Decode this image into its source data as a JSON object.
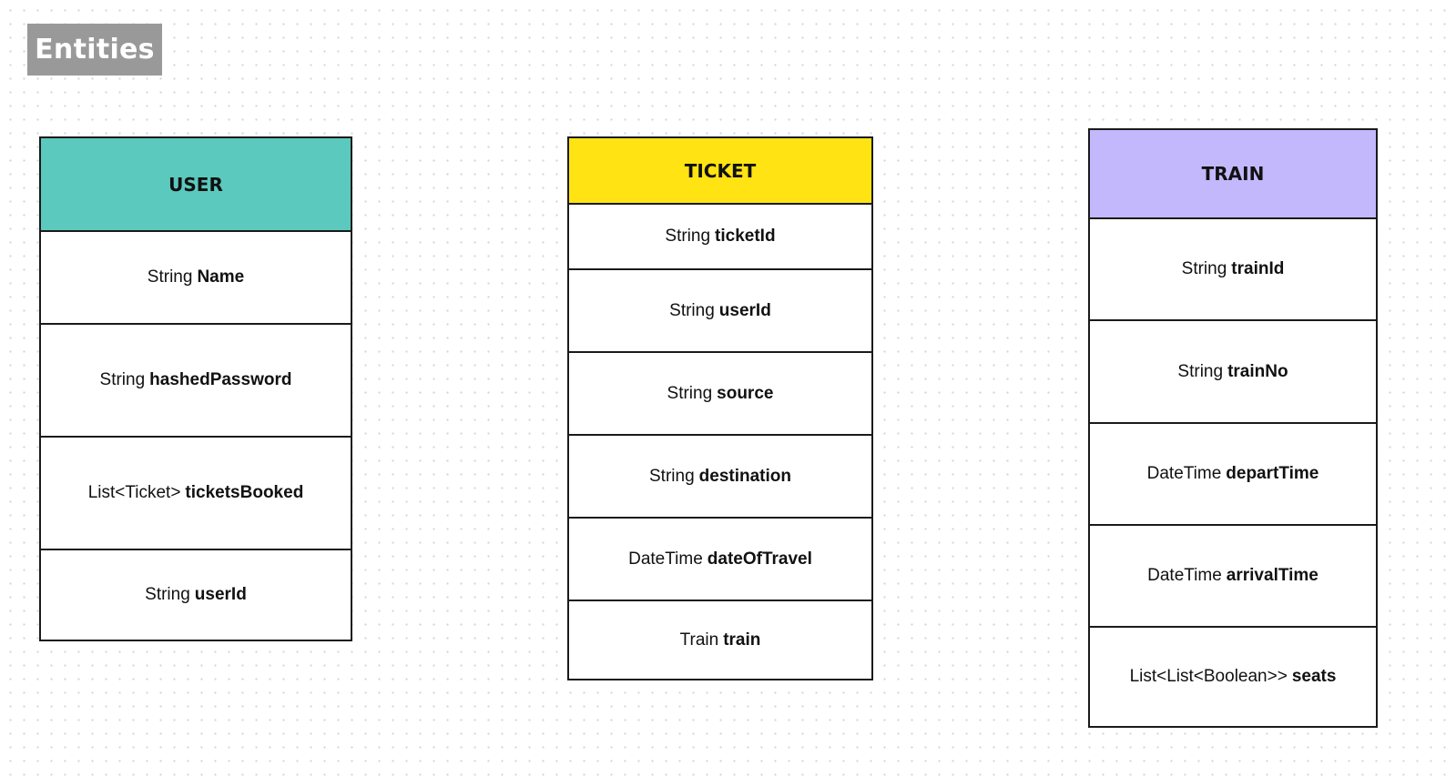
{
  "page": {
    "label": "Entities"
  },
  "colors": {
    "user_header": "#5bc9bd",
    "ticket_header": "#ffe312",
    "train_header": "#c4b8fc",
    "label_background": "#999999",
    "border": "#1a1a1a"
  },
  "entities": [
    {
      "id": "user",
      "title": "USER",
      "fields": [
        {
          "type": "String",
          "name": "Name"
        },
        {
          "type": "String",
          "name": "hashedPassword"
        },
        {
          "type": "List<Ticket>",
          "name": "ticketsBooked"
        },
        {
          "type": "String",
          "name": "userId"
        }
      ]
    },
    {
      "id": "ticket",
      "title": "TICKET",
      "fields": [
        {
          "type": "String",
          "name": "ticketId"
        },
        {
          "type": "String",
          "name": "userId"
        },
        {
          "type": "String",
          "name": "source"
        },
        {
          "type": "String",
          "name": "destination"
        },
        {
          "type": "DateTime",
          "name": "dateOfTravel"
        },
        {
          "type": "Train",
          "name": "train"
        }
      ]
    },
    {
      "id": "train",
      "title": "TRAIN",
      "fields": [
        {
          "type": "String",
          "name": "trainId"
        },
        {
          "type": "String",
          "name": "trainNo"
        },
        {
          "type": "DateTime",
          "name": "departTime"
        },
        {
          "type": "DateTime",
          "name": "arrivalTime"
        },
        {
          "type": "List<List<Boolean>>",
          "name": "seats"
        }
      ]
    }
  ]
}
